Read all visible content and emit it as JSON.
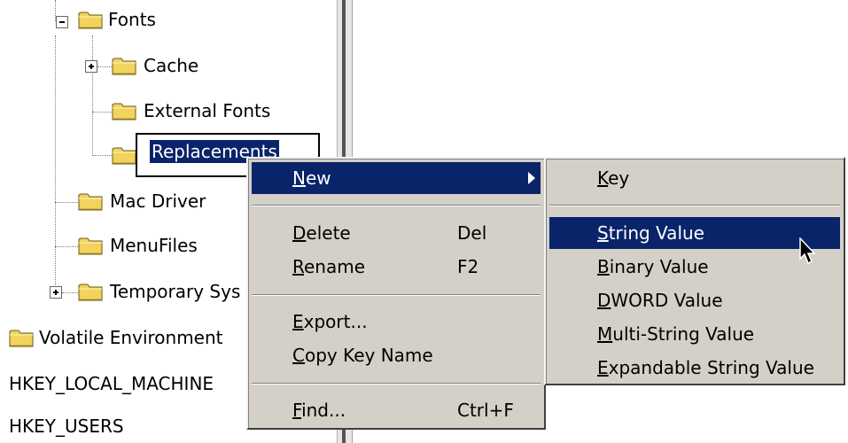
{
  "tree": {
    "fonts": "Fonts",
    "cache": "Cache",
    "external_fonts": "External Fonts",
    "replacements": "Replacements",
    "mac_driver": "Mac Driver",
    "menu_files": "MenuFiles",
    "temporary_sys": "Temporary Sys",
    "volatile_environment": "Volatile Environment",
    "hklm": "HKEY_LOCAL_MACHINE",
    "hku": "HKEY_USERS"
  },
  "context_menu": {
    "new": {
      "pre": "",
      "u": "N",
      "post": "ew"
    },
    "delete": {
      "pre": "",
      "u": "D",
      "post": "elete",
      "shortcut": "Del"
    },
    "rename": {
      "pre": "",
      "u": "R",
      "post": "ename",
      "shortcut": "F2"
    },
    "export": {
      "pre": "",
      "u": "E",
      "post": "xport..."
    },
    "copy_key_name": {
      "pre": "",
      "u": "C",
      "post": "opy Key Name"
    },
    "find": {
      "pre": "",
      "u": "F",
      "post": "ind...",
      "shortcut": "Ctrl+F"
    }
  },
  "submenu": {
    "key": {
      "u": "K",
      "post": "ey"
    },
    "string_value": {
      "u": "S",
      "post": "tring Value"
    },
    "binary_value": {
      "u": "B",
      "post": "inary Value"
    },
    "dword_value": {
      "u": "D",
      "post": "WORD Value"
    },
    "multi_string_value": {
      "u": "M",
      "post": "ulti-String Value"
    },
    "expandable_string_value": {
      "u": "E",
      "post": "xpandable String Value"
    }
  },
  "colors": {
    "selection": "#0a246a",
    "menu_bg": "#d4d0c8",
    "folder": "#f5d75a"
  }
}
